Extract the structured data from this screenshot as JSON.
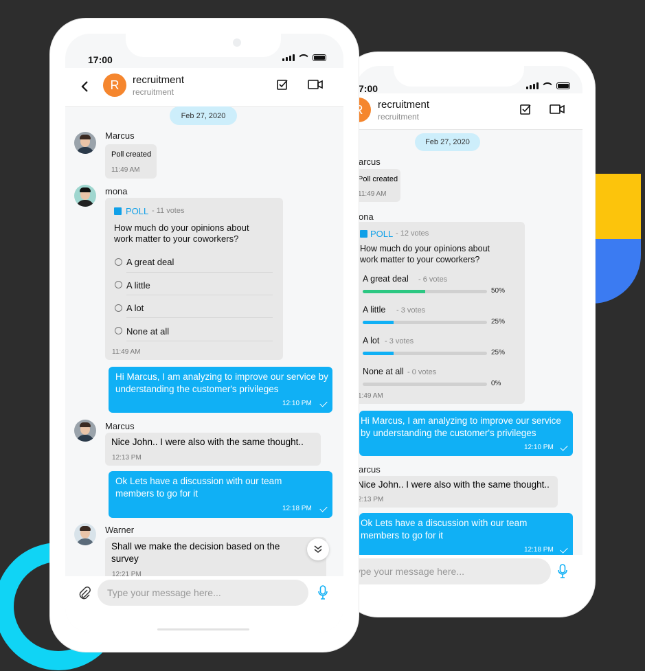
{
  "colors": {
    "accent": "#10b0f5",
    "avatar": "#f5862e",
    "pill": "#cdeefb",
    "bar_fill_green": "#2cc782",
    "bar_fill_blue": "#10b0f5"
  },
  "status": {
    "time": "17:00"
  },
  "chat": {
    "avatar_letter": "R",
    "title": "recruitment",
    "subtitle": "recruitment",
    "date": "Feb 27, 2020"
  },
  "composer": {
    "placeholder": "Type your message here...",
    "placeholder_partial": "ype your message here..."
  },
  "front": {
    "m1": {
      "sender": "Marcus",
      "text": "Poll created",
      "time": "11:49 AM"
    },
    "m2": {
      "sender": "mona",
      "poll_label": "POLL",
      "votes": "- 11 votes",
      "question": "How much do your opinions about work matter to your coworkers?",
      "options": [
        "A great deal",
        "A little",
        "A lot",
        "None at all"
      ],
      "time": "11:49 AM"
    },
    "m3": {
      "text": "Hi Marcus, I am analyzing to improve our service by understanding the customer's privileges",
      "time": "12:10 PM"
    },
    "m4": {
      "sender": "Marcus",
      "text": "Nice John.. I were also with the same thought..",
      "time": "12:13 PM"
    },
    "m5": {
      "text": "Ok Lets have a discussion with our team members to  go for it",
      "time": "12:18 PM"
    },
    "m6": {
      "sender": "Warner",
      "text": "Shall we make the decision based on the survey",
      "time": "12:21 PM"
    }
  },
  "back": {
    "time_partial": "7:00",
    "m1": {
      "sender": "arcus",
      "text": "Poll created",
      "time": "11:49 AM"
    },
    "m2": {
      "sender": "ona",
      "poll_label": "POLL",
      "votes": "- 12 votes",
      "question": "How much do your opinions about work matter to your coworkers?",
      "options": [
        {
          "label": "A great deal",
          "votes": "- 6 votes",
          "pct": "50%",
          "fraction": 0.5
        },
        {
          "label": "A little",
          "votes": "- 3 votes",
          "pct": "25%",
          "fraction": 0.25
        },
        {
          "label": "A lot",
          "votes": "- 3 votes",
          "pct": "25%",
          "fraction": 0.25
        },
        {
          "label": "None at all",
          "votes": "- 0 votes",
          "pct": "0%",
          "fraction": 0
        }
      ],
      "time": "1:49 AM"
    },
    "m3": {
      "text": "Hi Marcus, I am analyzing to improve our service by understanding the customer's privileges",
      "time": "12:10 PM"
    },
    "m4": {
      "sender": "arcus",
      "text": "Nice John.. I were also with the same thought..",
      "time": "2:13 PM"
    },
    "m5": {
      "text": "Ok Lets have a discussion with our team members to  go for it",
      "time": "12:18 PM"
    }
  }
}
